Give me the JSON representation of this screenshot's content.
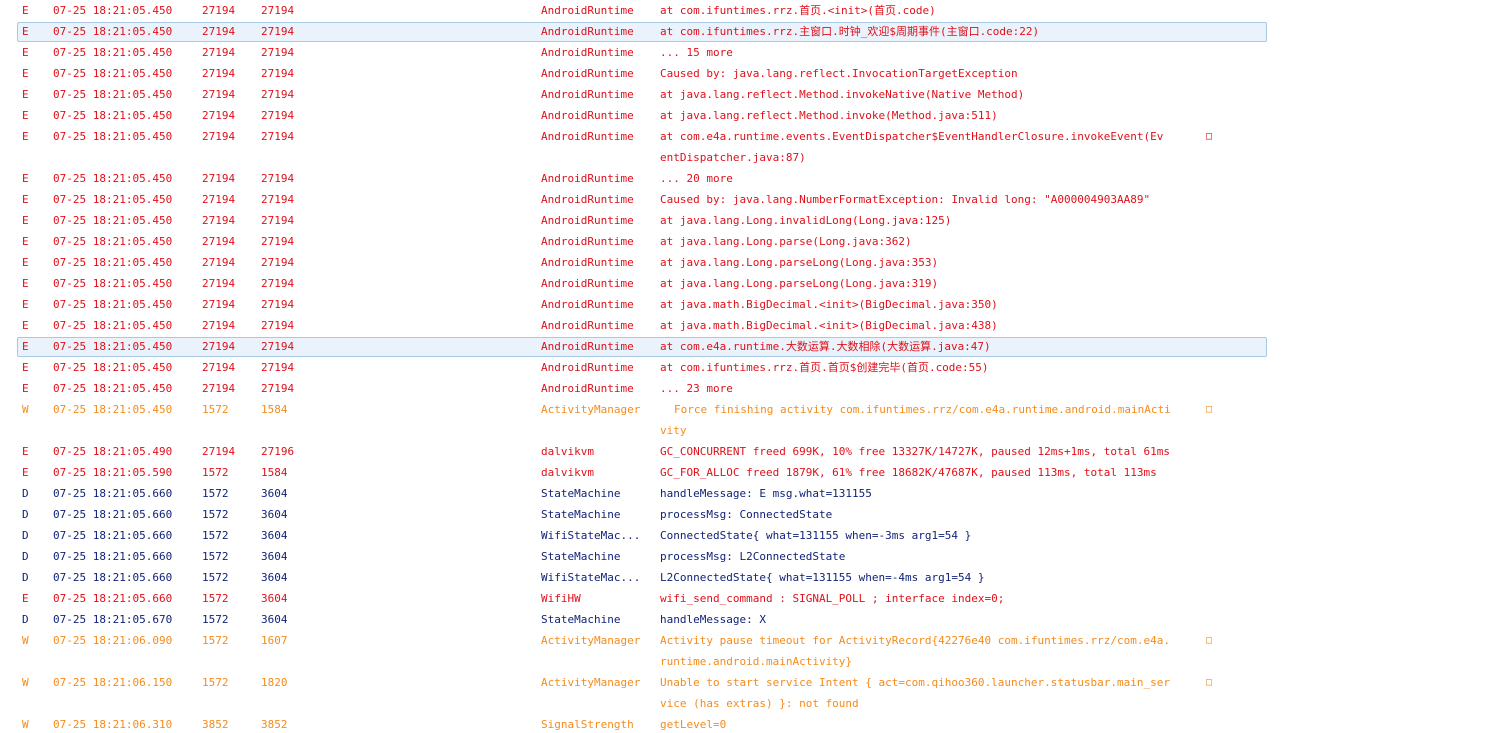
{
  "colors": {
    "error": "#e0101a",
    "warning": "#f58b1c",
    "debug": "#112277",
    "selection_bg": "#eaf3fb",
    "selection_border": "#a9c8e6"
  },
  "wrap_glyph": "□",
  "rows": [
    {
      "level": "E",
      "time": "07-25 18:21:05.450",
      "pid": "27194",
      "tid": "27194",
      "tag": "AndroidRuntime",
      "text": "at com.ifuntimes.rrz.首页.<init>(首页.code)"
    },
    {
      "level": "E",
      "time": "07-25 18:21:05.450",
      "pid": "27194",
      "tid": "27194",
      "tag": "AndroidRuntime",
      "text": "at com.ifuntimes.rrz.主窗口.时钟_欢迎$周期事件(主窗口.code:22)",
      "selected": true
    },
    {
      "level": "E",
      "time": "07-25 18:21:05.450",
      "pid": "27194",
      "tid": "27194",
      "tag": "AndroidRuntime",
      "text": "... 15 more"
    },
    {
      "level": "E",
      "time": "07-25 18:21:05.450",
      "pid": "27194",
      "tid": "27194",
      "tag": "AndroidRuntime",
      "text": "Caused by: java.lang.reflect.InvocationTargetException"
    },
    {
      "level": "E",
      "time": "07-25 18:21:05.450",
      "pid": "27194",
      "tid": "27194",
      "tag": "AndroidRuntime",
      "text": "at java.lang.reflect.Method.invokeNative(Native Method)"
    },
    {
      "level": "E",
      "time": "07-25 18:21:05.450",
      "pid": "27194",
      "tid": "27194",
      "tag": "AndroidRuntime",
      "text": "at java.lang.reflect.Method.invoke(Method.java:511)"
    },
    {
      "level": "E",
      "time": "07-25 18:21:05.450",
      "pid": "27194",
      "tid": "27194",
      "tag": "AndroidRuntime",
      "text": "at com.e4a.runtime.events.EventDispatcher$EventHandlerClosure.invokeEvent(Ev",
      "wrap": true
    },
    {
      "level": "E",
      "continuation": true,
      "text": "entDispatcher.java:87)"
    },
    {
      "level": "E",
      "time": "07-25 18:21:05.450",
      "pid": "27194",
      "tid": "27194",
      "tag": "AndroidRuntime",
      "text": "... 20 more"
    },
    {
      "level": "E",
      "time": "07-25 18:21:05.450",
      "pid": "27194",
      "tid": "27194",
      "tag": "AndroidRuntime",
      "text": "Caused by: java.lang.NumberFormatException: Invalid long: \"A000004903AA89\""
    },
    {
      "level": "E",
      "time": "07-25 18:21:05.450",
      "pid": "27194",
      "tid": "27194",
      "tag": "AndroidRuntime",
      "text": "at java.lang.Long.invalidLong(Long.java:125)"
    },
    {
      "level": "E",
      "time": "07-25 18:21:05.450",
      "pid": "27194",
      "tid": "27194",
      "tag": "AndroidRuntime",
      "text": "at java.lang.Long.parse(Long.java:362)"
    },
    {
      "level": "E",
      "time": "07-25 18:21:05.450",
      "pid": "27194",
      "tid": "27194",
      "tag": "AndroidRuntime",
      "text": "at java.lang.Long.parseLong(Long.java:353)"
    },
    {
      "level": "E",
      "time": "07-25 18:21:05.450",
      "pid": "27194",
      "tid": "27194",
      "tag": "AndroidRuntime",
      "text": "at java.lang.Long.parseLong(Long.java:319)"
    },
    {
      "level": "E",
      "time": "07-25 18:21:05.450",
      "pid": "27194",
      "tid": "27194",
      "tag": "AndroidRuntime",
      "text": "at java.math.BigDecimal.<init>(BigDecimal.java:350)"
    },
    {
      "level": "E",
      "time": "07-25 18:21:05.450",
      "pid": "27194",
      "tid": "27194",
      "tag": "AndroidRuntime",
      "text": "at java.math.BigDecimal.<init>(BigDecimal.java:438)"
    },
    {
      "level": "E",
      "time": "07-25 18:21:05.450",
      "pid": "27194",
      "tid": "27194",
      "tag": "AndroidRuntime",
      "text": "at com.e4a.runtime.大数运算.大数相除(大数运算.java:47)",
      "selected": true
    },
    {
      "level": "E",
      "time": "07-25 18:21:05.450",
      "pid": "27194",
      "tid": "27194",
      "tag": "AndroidRuntime",
      "text": "at com.ifuntimes.rrz.首页.首页$创建完毕(首页.code:55)"
    },
    {
      "level": "E",
      "time": "07-25 18:21:05.450",
      "pid": "27194",
      "tid": "27194",
      "tag": "AndroidRuntime",
      "text": "... 23 more"
    },
    {
      "level": "W",
      "time": "07-25 18:21:05.450",
      "pid": "1572",
      "tid": "1584",
      "tag": "ActivityManager",
      "text": "Force finishing activity com.ifuntimes.rrz/com.e4a.runtime.android.mainActi",
      "indent": true,
      "wrap": true
    },
    {
      "level": "W",
      "continuation": true,
      "text": "vity"
    },
    {
      "level": "E",
      "time": "07-25 18:21:05.490",
      "pid": "27194",
      "tid": "27196",
      "tag": "dalvikvm",
      "text": "GC_CONCURRENT freed 699K, 10% free 13327K/14727K, paused 12ms+1ms, total 61ms"
    },
    {
      "level": "E",
      "time": "07-25 18:21:05.590",
      "pid": "1572",
      "tid": "1584",
      "tag": "dalvikvm",
      "text": "GC_FOR_ALLOC freed 1879K, 61% free 18682K/47687K, paused 113ms, total 113ms"
    },
    {
      "level": "D",
      "time": "07-25 18:21:05.660",
      "pid": "1572",
      "tid": "3604",
      "tag": "StateMachine",
      "text": "handleMessage: E msg.what=131155"
    },
    {
      "level": "D",
      "time": "07-25 18:21:05.660",
      "pid": "1572",
      "tid": "3604",
      "tag": "StateMachine",
      "text": "processMsg: ConnectedState"
    },
    {
      "level": "D",
      "time": "07-25 18:21:05.660",
      "pid": "1572",
      "tid": "3604",
      "tag": "WifiStateMac...",
      "text": "ConnectedState{ what=131155 when=-3ms arg1=54 }"
    },
    {
      "level": "D",
      "time": "07-25 18:21:05.660",
      "pid": "1572",
      "tid": "3604",
      "tag": "StateMachine",
      "text": "processMsg: L2ConnectedState"
    },
    {
      "level": "D",
      "time": "07-25 18:21:05.660",
      "pid": "1572",
      "tid": "3604",
      "tag": "WifiStateMac...",
      "text": "L2ConnectedState{ what=131155 when=-4ms arg1=54 }"
    },
    {
      "level": "E",
      "time": "07-25 18:21:05.660",
      "pid": "1572",
      "tid": "3604",
      "tag": "WifiHW",
      "text": "wifi_send_command : SIGNAL_POLL ; interface index=0;"
    },
    {
      "level": "D",
      "time": "07-25 18:21:05.670",
      "pid": "1572",
      "tid": "3604",
      "tag": "StateMachine",
      "text": "handleMessage: X"
    },
    {
      "level": "W",
      "time": "07-25 18:21:06.090",
      "pid": "1572",
      "tid": "1607",
      "tag": "ActivityManager",
      "text": "Activity pause timeout for ActivityRecord{42276e40 com.ifuntimes.rrz/com.e4a.",
      "wrap": true
    },
    {
      "level": "W",
      "continuation": true,
      "text": "runtime.android.mainActivity}"
    },
    {
      "level": "W",
      "time": "07-25 18:21:06.150",
      "pid": "1572",
      "tid": "1820",
      "tag": "ActivityManager",
      "text": "Unable to start service Intent { act=com.qihoo360.launcher.statusbar.main_ser",
      "wrap": true
    },
    {
      "level": "W",
      "continuation": true,
      "text": "vice (has extras) }: not found"
    },
    {
      "level": "W",
      "time": "07-25 18:21:06.310",
      "pid": "3852",
      "tid": "3852",
      "tag": "SignalStrength",
      "text": "getLevel=0"
    }
  ]
}
